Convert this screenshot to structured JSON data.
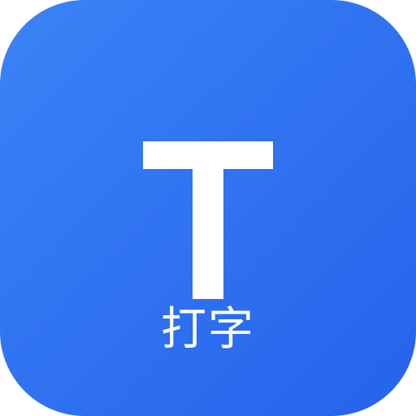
{
  "app_icon": {
    "name": "typing-app-icon",
    "label": "打字",
    "glyph_letter": "T",
    "colors": {
      "background_start": "#3b82f6",
      "background_end": "#2563eb",
      "foreground": "#ffffff"
    }
  }
}
